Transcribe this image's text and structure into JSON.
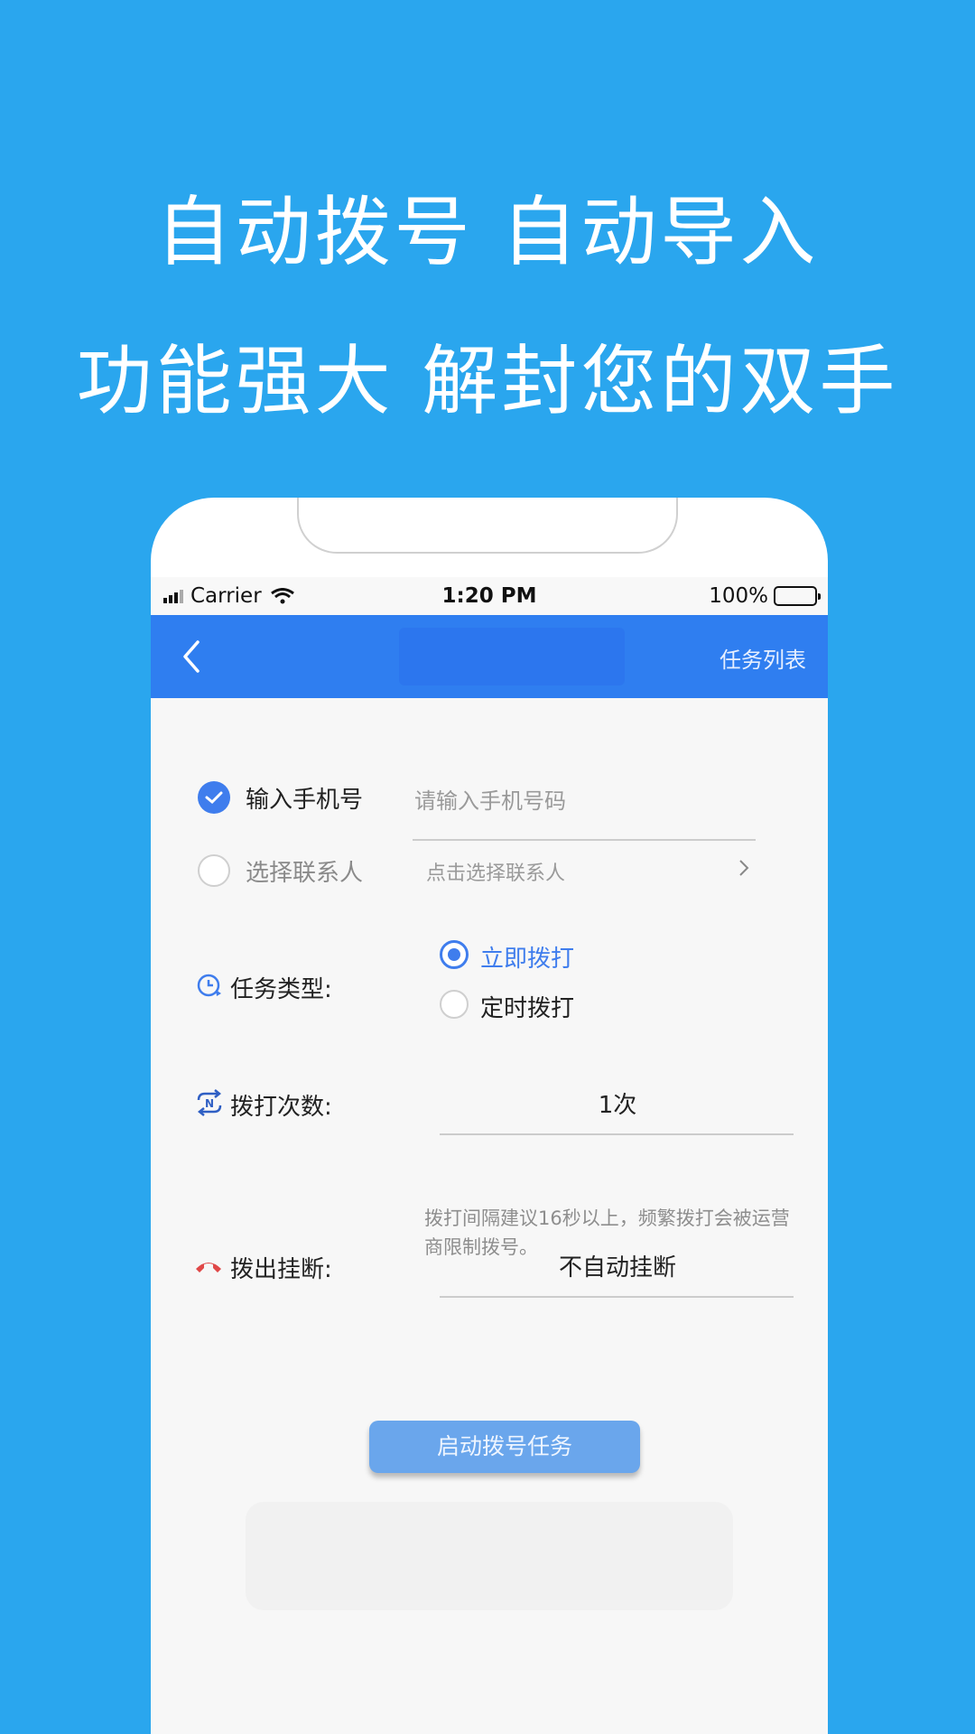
{
  "headline": {
    "line1": "自动拨号 自动导入",
    "line2": "功能强大 解封您的双手"
  },
  "status_bar": {
    "carrier": "Carrier",
    "time": "1:20 PM",
    "battery": "100%"
  },
  "nav": {
    "right_label": "任务列表"
  },
  "form": {
    "phone_option_label": "输入手机号",
    "phone_placeholder": "请输入手机号码",
    "contact_option_label": "选择联系人",
    "contact_hint": "点击选择联系人",
    "task_type_label": "任务类型:",
    "task_type_options": [
      "立即拨打",
      "定时拨打"
    ],
    "dial_count_label": "拨打次数:",
    "dial_count_value": "1次",
    "interval_note": "拨打间隔建议16秒以上，频繁拨打会被运营商限制拨号。",
    "hangup_label": "拨出挂断:",
    "hangup_value": "不自动挂断",
    "start_button": "启动拨号任务"
  },
  "colors": {
    "background": "#2aa6ee",
    "nav_bar": "#2f7ef0",
    "accent": "#3f7ded",
    "button": "#6aa6ec",
    "hangup_icon": "#e04848"
  },
  "icons": {
    "back": "chevron-left-icon",
    "contact_arrow": "chevron-right-icon",
    "task_type": "clock-icon",
    "dial_count": "repeat-icon",
    "hangup": "phone-hangup-icon"
  }
}
